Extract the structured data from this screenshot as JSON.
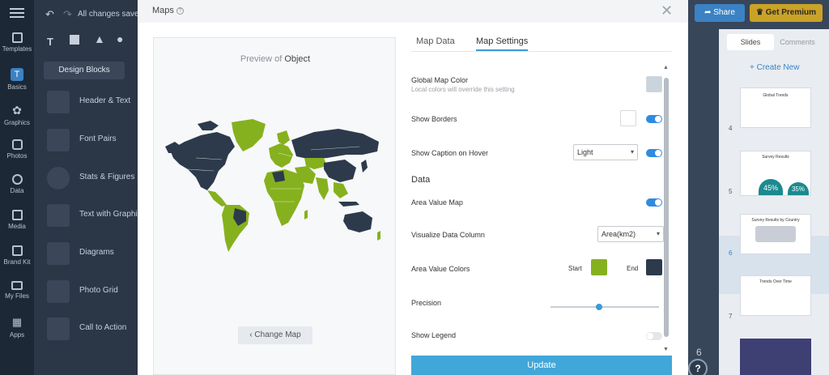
{
  "colors": {
    "map_green": "#86b11e",
    "map_navy": "#2d3a4b",
    "accent_blue": "#2f8be0",
    "update_blue": "#41a7d8",
    "premium_gold": "#c9a227"
  },
  "rail": [
    {
      "name": "Templates",
      "icon": "templates-icon"
    },
    {
      "name": "Basics",
      "icon": "basics-icon"
    },
    {
      "name": "Graphics",
      "icon": "graphics-icon"
    },
    {
      "name": "Photos",
      "icon": "photos-icon"
    },
    {
      "name": "Data",
      "icon": "data-icon"
    },
    {
      "name": "Media",
      "icon": "media-icon"
    },
    {
      "name": "Brand Kit",
      "icon": "brand-kit-icon"
    },
    {
      "name": "My Files",
      "icon": "my-files-icon"
    },
    {
      "name": "Apps",
      "icon": "apps-icon"
    }
  ],
  "panel": {
    "saved_status": "All changes saved",
    "design_blocks": "Design Blocks",
    "blocks": [
      "Header & Text",
      "Font Pairs",
      "Stats & Figures",
      "Text with Graphics",
      "Diagrams",
      "Photo Grid",
      "Call to Action"
    ]
  },
  "topbar": {
    "share": "Share",
    "premium": "Get Premium"
  },
  "slides_panel": {
    "tab_slides": "Slides",
    "tab_comments": "Comments",
    "create_new": "+ Create New",
    "numbers": [
      "4",
      "5",
      "6",
      "7"
    ],
    "page_number": "6",
    "slide_titles": [
      "Global Trends",
      "Survey Results",
      "Survey Results by Country",
      "Trends Over Time"
    ],
    "slide5_values": [
      "45%",
      "35%"
    ]
  },
  "modal": {
    "title": "Maps",
    "preview_prefix": "Preview of",
    "preview_object": "Object",
    "change_map": "Change Map",
    "tabs": [
      "Map Data",
      "Map Settings"
    ],
    "global_color": "Global Map Color",
    "global_color_note": "Local colors will override this setting",
    "show_borders": "Show Borders",
    "show_caption": "Show Caption on Hover",
    "caption_select": "Light",
    "data_heading": "Data",
    "area_value_map": "Area Value Map",
    "visualize_column": "Visualize Data Column",
    "visualize_select": "Area(km2)",
    "area_value_colors": "Area Value Colors",
    "start": "Start",
    "end": "End",
    "precision": "Precision",
    "precision_value": 0.45,
    "show_legend": "Show Legend",
    "update": "Update"
  }
}
